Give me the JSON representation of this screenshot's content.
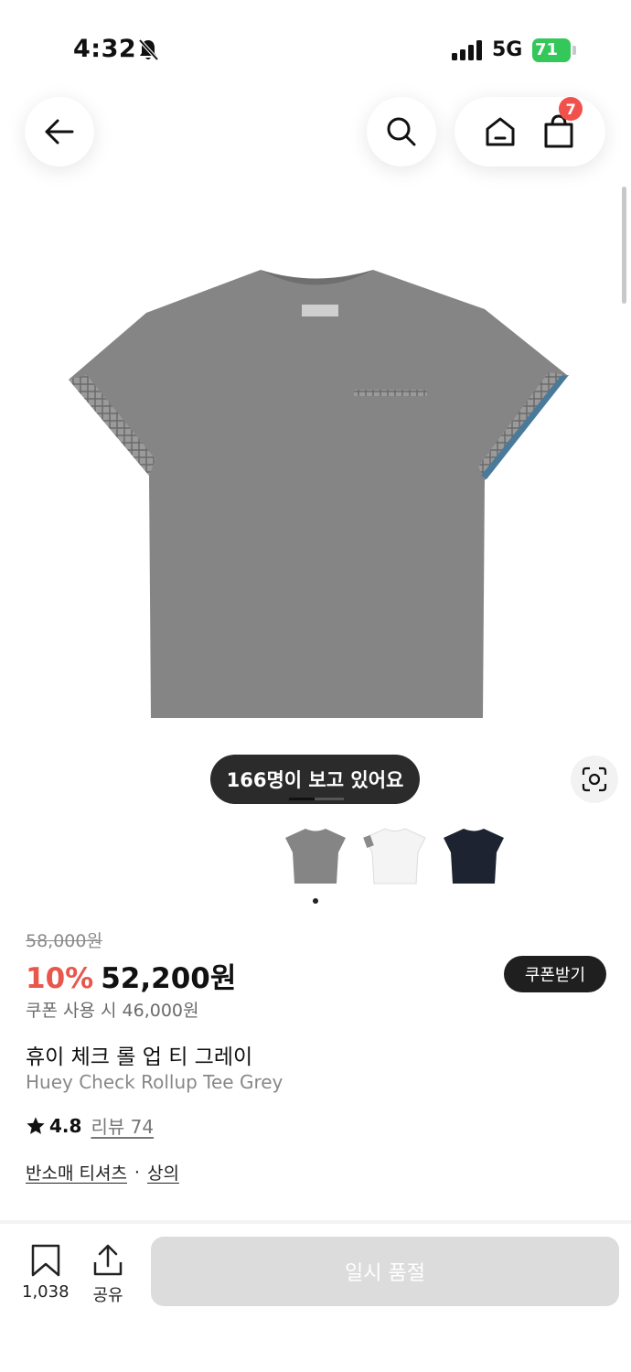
{
  "status_bar": {
    "time": "4:32",
    "network": "5G",
    "battery": "71"
  },
  "nav": {
    "cart_count": "7",
    "icons": [
      "back-arrow-icon",
      "search-icon",
      "home-icon",
      "shopping-bag-icon"
    ]
  },
  "gallery": {
    "viewers_text": "166명이 보고 있어요",
    "color_options": [
      "grey",
      "white",
      "navy"
    ],
    "colors": {
      "grey": "#8c8c8c",
      "white": "#f4f4f4",
      "navy": "#1d2330"
    }
  },
  "price": {
    "original": "58,000원",
    "discount_rate": "10%",
    "sale": "52,200원",
    "coupon_button": "쿠폰받기",
    "coupon_price": "쿠폰 사용 시 46,000원"
  },
  "product": {
    "name_ko": "휴이 체크 롤 업 티 그레이",
    "name_en": "Huey Check Rollup Tee Grey",
    "rating": "4.8",
    "review_label": "리뷰 74",
    "category_1": "반소매 티셔츠",
    "category_sep": "·",
    "category_2": "상의"
  },
  "bottom": {
    "bookmark_count": "1,038",
    "share_label": "공유",
    "soldout_label": "일시 품절"
  },
  "theme": {
    "accent_red": "#e9564b",
    "badge_red": "#f0524b",
    "battery_green": "#34c759"
  }
}
